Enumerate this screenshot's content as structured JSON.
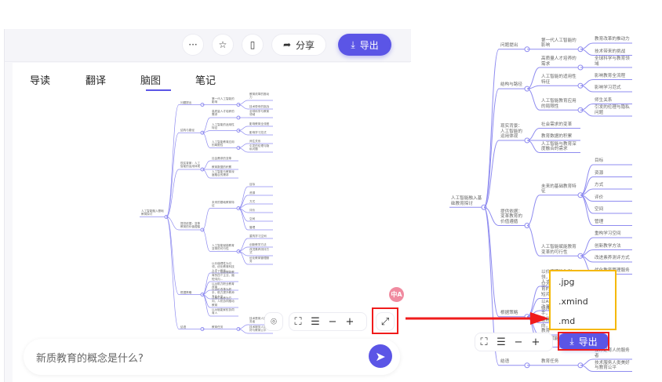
{
  "header": {
    "more_label": "···",
    "share_label": "分享",
    "export_label": "导出"
  },
  "tabs": [
    {
      "label": "导读"
    },
    {
      "label": "翻译"
    },
    {
      "label": "脑图",
      "active": true
    },
    {
      "label": "笔记"
    }
  ],
  "chat": {
    "placeholder": "新质教育的概念是什么?"
  },
  "translate_badge": "中A",
  "toolbar": {
    "zoom_out": "−",
    "zoom_in": "+"
  },
  "export_menu": {
    "options": [
      ".jpg",
      ".xmind",
      ".md"
    ],
    "button_label": "导出"
  },
  "colors": {
    "accent": "#5b55e6",
    "highlight": "#f01c1c",
    "dropdown_border": "#f5b800"
  },
  "mindmap": {
    "label": "人工智能融入基础教育探讨",
    "children": [
      {
        "label": "问题提出",
        "children": [
          {
            "label": "第一代人工智能的影响",
            "children": [
              {
                "label": "教育改革的推动力"
              },
              {
                "label": "技术带来的挑战"
              }
            ]
          }
        ]
      },
      {
        "label": "结构与路径",
        "children": [
          {
            "label": "高质量人才培养的需求",
            "children": [
              {
                "label": "全球科学与教育领域"
              }
            ]
          },
          {
            "label": "人工智能的适用性特征",
            "children": [
              {
                "label": "影响教育全流程"
              },
              {
                "label": "影响学习范式"
              }
            ]
          },
          {
            "label": "人工智能教育应用的局限性",
            "children": [
              {
                "label": "师生关系"
              },
              {
                "label": "引发的伦理与隐私问题"
              }
            ]
          }
        ]
      },
      {
        "label": "现实背景：人工智能的运用体现",
        "children": [
          {
            "label": "社会需求的变革"
          },
          {
            "label": "教育数据的积累"
          },
          {
            "label": "人工智能与教育深度融合的需求"
          }
        ]
      },
      {
        "label": "提供依据：变革教育的价值遵循",
        "children": [
          {
            "label": "未来的基础教育特征",
            "children": [
              {
                "label": "目标"
              },
              {
                "label": "资源"
              },
              {
                "label": "方式"
              },
              {
                "label": "评价"
              },
              {
                "label": "空间"
              },
              {
                "label": "管理"
              }
            ]
          },
          {
            "label": "人工智能赋能教育变革的可行性",
            "children": [
              {
                "label": "重构学习空间"
              },
              {
                "label": "创新教学方法"
              },
              {
                "label": "改进素养测评方式"
              },
              {
                "label": "优化教育管理服务"
              }
            ]
          }
        ]
      },
      {
        "label": "根据策略",
        "children": [
          {
            "label": "以价值理性为引领，优化教育科技人才一体化…"
          },
          {
            "label": "以人工智能赋能教育的四个主业，缩短鸿沟…"
          },
          {
            "label": "以AI助力职业教育改革"
          },
          {
            "label": "以评价改革为抓手，助力提升教师专业水平"
          },
          {
            "label": "以核心素养为方向，人机协同推动教育"
          },
          {
            "label": "以AI赋能家校协同育人"
          }
        ]
      },
      {
        "label": "结语",
        "children": [
          {
            "label": "教育任务",
            "children": [
              {
                "label": "技术是育人的服务者"
              },
              {
                "label": "技术服务人类美好与教育公平"
              }
            ]
          }
        ]
      }
    ]
  }
}
